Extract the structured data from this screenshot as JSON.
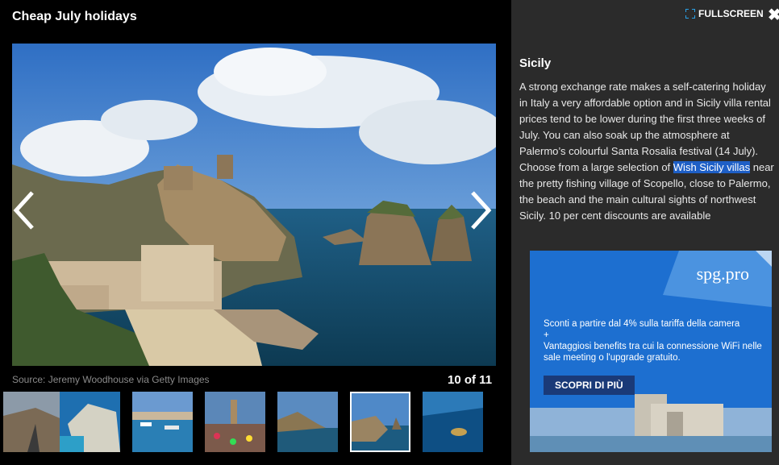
{
  "gallery": {
    "title": "Cheap July holidays",
    "source": "Source: Jeremy Woodhouse via Getty Images",
    "counter": "10 of 11",
    "prev_icon": "chevron-left-icon",
    "next_icon": "chevron-right-icon"
  },
  "sidebar": {
    "fullscreen_label": "FULLSCREEN",
    "fullscreen_icon": "expand-icon",
    "close_icon": "close-icon",
    "heading": "Sicily",
    "text_before": "A strong exchange rate makes a self-catering holiday in Italy a very affordable option and in Sicily villa rental prices tend to be lower during the first three weeks of July. You can also soak up the atmosphere at Palermo’s colourful Santa Rosalia festival (14 July). Choose from a large selection of ",
    "link_text": "Wish Sicily villas",
    "text_after": " near the pretty fishing village of Scopello, close to Palermo, the beach and the main cultural sights of northwest Sicily. 10 per cent discounts are available"
  },
  "ad": {
    "logo": "spg.pro",
    "line1": "Sconti a partire dal 4% sulla tariffa della camera",
    "line2": "+",
    "line3": "Vantaggiosi benefits tra cui la connessione WiFi nelle sale meeting o l'upgrade gratuito.",
    "button": "SCOPRI DI PIÙ"
  },
  "colors": {
    "highlight": "#1e5fc6",
    "panel": "#2b2b2b",
    "ad_blue": "#1d6fd0"
  }
}
